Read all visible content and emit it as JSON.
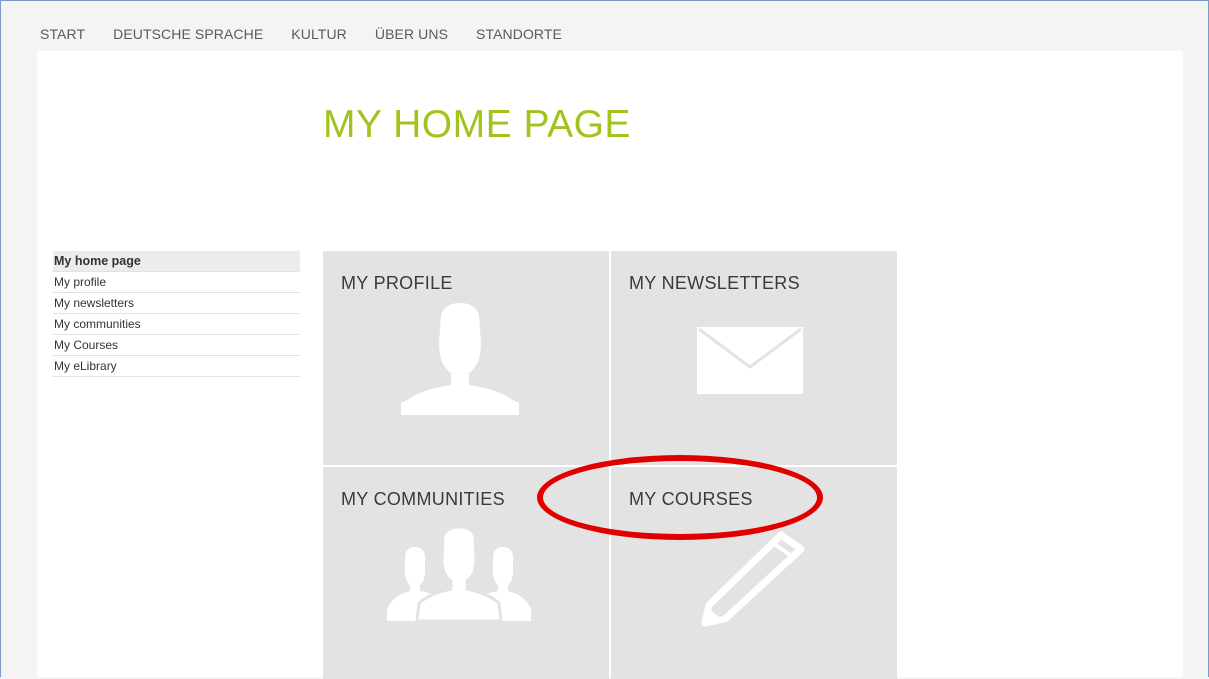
{
  "topnav": {
    "items": [
      {
        "label": "START"
      },
      {
        "label": "DEUTSCHE SPRACHE"
      },
      {
        "label": "KULTUR"
      },
      {
        "label": "ÜBER UNS"
      },
      {
        "label": "STANDORTE"
      }
    ]
  },
  "page": {
    "title": "MY HOME PAGE"
  },
  "sidebar": {
    "items": [
      {
        "label": "My home page",
        "active": true
      },
      {
        "label": "My profile"
      },
      {
        "label": "My newsletters"
      },
      {
        "label": "My communities"
      },
      {
        "label": "My Courses"
      },
      {
        "label": "My eLibrary"
      }
    ]
  },
  "tiles": [
    {
      "label": "MY PROFILE",
      "icon": "person-icon"
    },
    {
      "label": "MY NEWSLETTERS",
      "icon": "envelope-icon"
    },
    {
      "label": "MY COMMUNITIES",
      "icon": "group-icon"
    },
    {
      "label": "MY COURSES",
      "icon": "pencil-icon"
    }
  ],
  "colors": {
    "title_green": "#a0c31e",
    "tile_bg": "#e3e3e3",
    "highlight_red": "#e00000"
  }
}
